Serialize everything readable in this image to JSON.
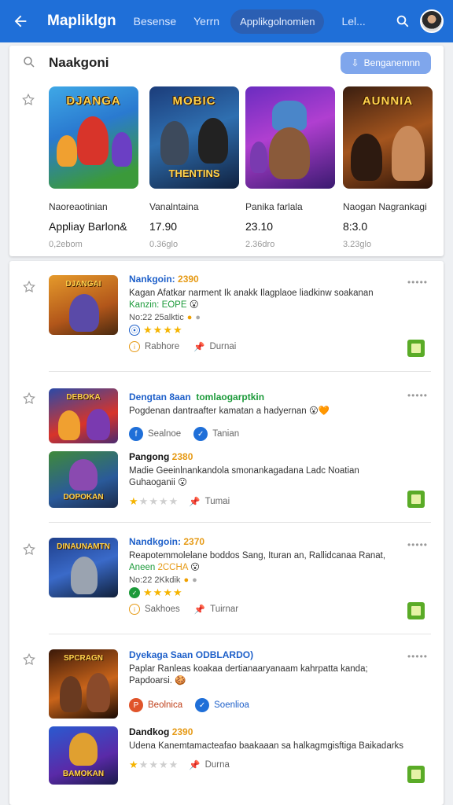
{
  "appbar": {
    "title": "Mapliklgn",
    "tab1": "Besense",
    "tab2": "Yerrn",
    "tab_active": "Applikgolnomien",
    "tab3": "Lel..."
  },
  "featured": {
    "title": "Naakgoni",
    "button_label": "Benganemnn",
    "items": [
      {
        "art_top": "DJANGA",
        "art_bottom": "",
        "name": "Naoreaotinian",
        "price": "Appliay Barlon&",
        "sub": "0,2ebom"
      },
      {
        "art_top": "MOBIC",
        "art_bottom": "THENTINS",
        "name": "Vanalntaina",
        "price": "17.90",
        "sub": "0.36glo",
        "name_prefix": ""
      },
      {
        "art_top": "",
        "art_bottom": "",
        "name": "Panika farlala",
        "price": "23.10",
        "sub": "2.36dro"
      },
      {
        "art_top": "AUNNIA",
        "art_bottom": "",
        "name": "Naogan Nagrankagi",
        "price": "8:3.0",
        "sub": "3.23glo"
      }
    ]
  },
  "list": [
    {
      "title": "Nankgoin:",
      "title_hl": "2390",
      "desc": "Kagan Afatkar narment Ik anakk Ilagplaoe liadkinw soakanan",
      "desc2_green": "Kanzin:",
      "desc2_rest": "EOPE",
      "meta": "No:22 25alktic",
      "rating": 4,
      "action1": "Rabhore",
      "action2": "Durnai",
      "art": "DJANGAI"
    },
    {
      "title": "Dengtan 8aan",
      "title_green": "tomlaogarptkin",
      "desc": "Pogdenan dantraafter kamatan a hadyernan",
      "action1": "Sealnoe",
      "action2": "Tanian",
      "art": "DEBOKA"
    },
    {
      "title": "Pangong",
      "title_hl": "2380",
      "desc": "Madie Geeinlnankandola smonankagadana Ladc Noatian Guhaoganii",
      "meta": "",
      "rating": 1,
      "action1": "",
      "action2": "Tumai",
      "art": "DOPOKAN"
    },
    {
      "title": "Nandkgoin:",
      "title_hl": "2370",
      "desc": "Reapotemmolelane boddos Sang, Ituran an, Rallidcanaa Ranat,",
      "desc2_green": "Aneen",
      "desc2_rest": "2CCHA",
      "meta": "No:22 2Kkdik",
      "rating": 4,
      "action1": "Sakhoes",
      "action2": "Tuirnar",
      "art": "DINAUNAMTN"
    },
    {
      "title": "Dyekaga Saan",
      "title_tail": "ODBLARDO)",
      "desc": "Paplar Ranleas koakaa dertianaaryanaam kahrpatta kanda; Papdoarsi.",
      "action1": "Beolnica",
      "action2": "Soenlioa",
      "art": "SPCRAGN"
    },
    {
      "title": "Dandkog",
      "title_hl": "2390",
      "desc": "Udena Kanemtamacteafao baakaaan sa halkagmgisftiga Baikadarks",
      "rating": 1,
      "action2": "Durna",
      "art": "BAMOKAN"
    }
  ],
  "colors": {
    "appbar": "#1f6fd8",
    "link": "#1d5fc9",
    "highlight": "#e69a15",
    "green": "#1c9a3a",
    "star": "#f5b400"
  }
}
